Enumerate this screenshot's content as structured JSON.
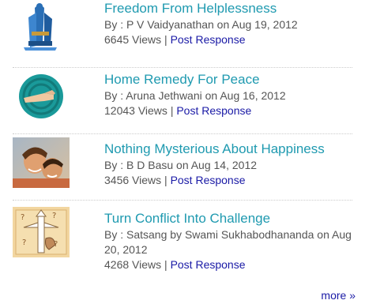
{
  "articles": [
    {
      "title": "Freedom From Helplessness",
      "byline": "By : P V Vaidyanathan on Aug 19, 2012",
      "views": "6645 Views",
      "separator": "|",
      "response_link": "Post Response",
      "thumbnail": "figure-with-chains-icon"
    },
    {
      "title": "Home Remedy For Peace",
      "byline": "By : Aruna Jethwani on Aug 16, 2012",
      "views": "12043 Views",
      "separator": "|",
      "response_link": "Post Response",
      "thumbnail": "hand-in-teal-circle-icon"
    },
    {
      "title": "Nothing Mysterious About Happiness",
      "byline": "By : B D Basu on Aug 14, 2012",
      "views": "3456 Views",
      "separator": "|",
      "response_link": "Post Response",
      "thumbnail": "smiling-couple-photo"
    },
    {
      "title": "Turn Conflict Into Challenge",
      "byline": "By : Satsang by Swami Sukhabodhananda on Aug 20, 2012",
      "views": "4268 Views",
      "separator": "|",
      "response_link": "Post Response",
      "thumbnail": "crossroads-question-marks-icon"
    }
  ],
  "footer": {
    "more_link": "more »"
  },
  "colors": {
    "title": "#1f9ab0",
    "link": "#1a1aa6",
    "meta": "#555555",
    "divider": "#cccccc"
  }
}
